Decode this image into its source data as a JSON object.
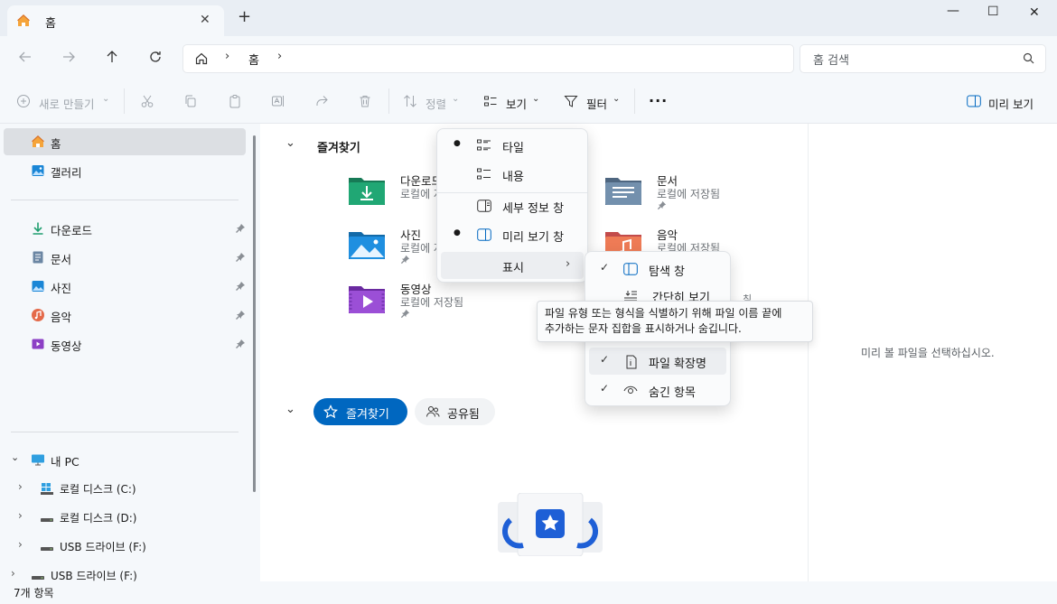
{
  "window": {
    "tab_title": "홈",
    "new_tab": "+",
    "controls": {
      "minimize": "—",
      "maximize": "☐",
      "close": "✕"
    }
  },
  "address": {
    "path": [
      "홈"
    ],
    "search_placeholder": "홈 검색"
  },
  "toolbar": {
    "new_label": "새로 만들기",
    "sort_label": "정렬",
    "view_label": "보기",
    "filter_label": "필터",
    "more_label": "···",
    "preview_label": "미리 보기"
  },
  "sidebar": {
    "top_items": [
      {
        "label": "홈",
        "icon": "home-icon",
        "selected": true
      },
      {
        "label": "갤러리",
        "icon": "gallery-icon"
      }
    ],
    "pinned_items": [
      {
        "label": "다운로드",
        "icon": "download-icon"
      },
      {
        "label": "문서",
        "icon": "document-icon"
      },
      {
        "label": "사진",
        "icon": "picture-icon"
      },
      {
        "label": "음악",
        "icon": "music-icon"
      },
      {
        "label": "동영상",
        "icon": "video-icon"
      }
    ],
    "pc": {
      "label": "내 PC",
      "drives": [
        "로컬 디스크 (C:)",
        "로컬 디스크 (D:)",
        "USB 드라이브 (F:)"
      ],
      "extra": "USB 드라이브 (F:)"
    }
  },
  "content": {
    "quick_access_header": "즐겨찾기",
    "tiles": [
      {
        "name": "다운로드",
        "sub": "로컬에 저장됨",
        "icon": "downloads-folder-icon",
        "color": "#1f9e6f"
      },
      {
        "name": "문서",
        "sub": "로컬에 저장됨",
        "icon": "documents-folder-icon",
        "color": "#5d7a99"
      },
      {
        "name": "사진",
        "sub": "로컬에 저장됨",
        "icon": "pictures-folder-icon",
        "color": "#1a86d6"
      },
      {
        "name": "음악",
        "sub": "로컬에 저장됨",
        "icon": "music-folder-icon",
        "color": "#e46a4a"
      },
      {
        "name": "동영상",
        "sub": "로컬에 저장됨",
        "icon": "videos-folder-icon",
        "color": "#8c3fc5"
      }
    ],
    "tabs": {
      "favorites": "즐겨찾기",
      "shared": "공유됨"
    }
  },
  "view_menu": {
    "items": [
      {
        "label": "타일",
        "bullet": true
      },
      {
        "label": "내용",
        "bullet": false
      },
      {
        "label": "세부 정보 창",
        "bullet": false
      },
      {
        "label": "미리 보기 창",
        "bullet": true
      },
      {
        "label": "표시",
        "submenu": true
      }
    ]
  },
  "show_submenu": {
    "items": [
      {
        "label": "탐색 창",
        "checked": true
      },
      {
        "label": "간단히 보기",
        "checked": false
      },
      {
        "label": "파일 확장명",
        "checked": true
      },
      {
        "label": "숨긴 항목",
        "checked": true
      }
    ],
    "partial_text": "침미"
  },
  "tooltip": {
    "line1": "파일 유형 또는 형식을 식별하기 위해 파일 이름 끝에",
    "line2": "추가하는 문자 집합을 표시하거나 숨깁니다."
  },
  "preview": {
    "message": "미리 볼 파일을 선택하십시오."
  },
  "status": {
    "count": "7개 항목"
  },
  "colors": {
    "accent": "#0067c0",
    "chrome": "#e9eef4",
    "pane": "#f5f8fb"
  }
}
